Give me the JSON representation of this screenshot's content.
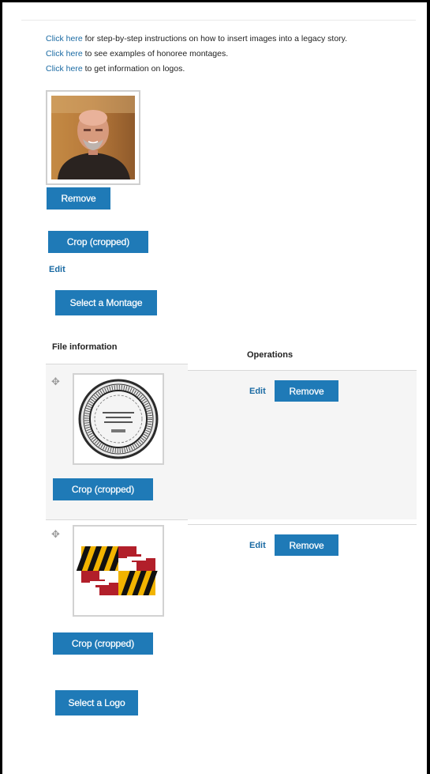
{
  "instructions": [
    {
      "link": "Click here",
      "text": " for step-by-step instructions on how to insert images into a legacy story."
    },
    {
      "link": "Click here",
      "text": " to see examples of honoree montages."
    },
    {
      "link": "Click here",
      "text": " to get information on logos."
    }
  ],
  "montage": {
    "remove_label": "Remove",
    "crop_label": "Crop (cropped)",
    "edit_label": "Edit",
    "select_label": "Select a Montage"
  },
  "logos_table": {
    "headers": {
      "file_info": "File information",
      "operations": "Operations"
    },
    "rows": [
      {
        "thumb_icon": "seal-icon",
        "crop_label": "Crop (cropped)",
        "edit_label": "Edit",
        "remove_label": "Remove"
      },
      {
        "thumb_icon": "flag-icon",
        "crop_label": "Crop (cropped)",
        "edit_label": "Edit",
        "remove_label": "Remove"
      }
    ],
    "select_label": "Select a Logo"
  },
  "colors": {
    "accent": "#1f7ab7",
    "link": "#1a6aa3",
    "row_bg": "#f5f5f5"
  }
}
